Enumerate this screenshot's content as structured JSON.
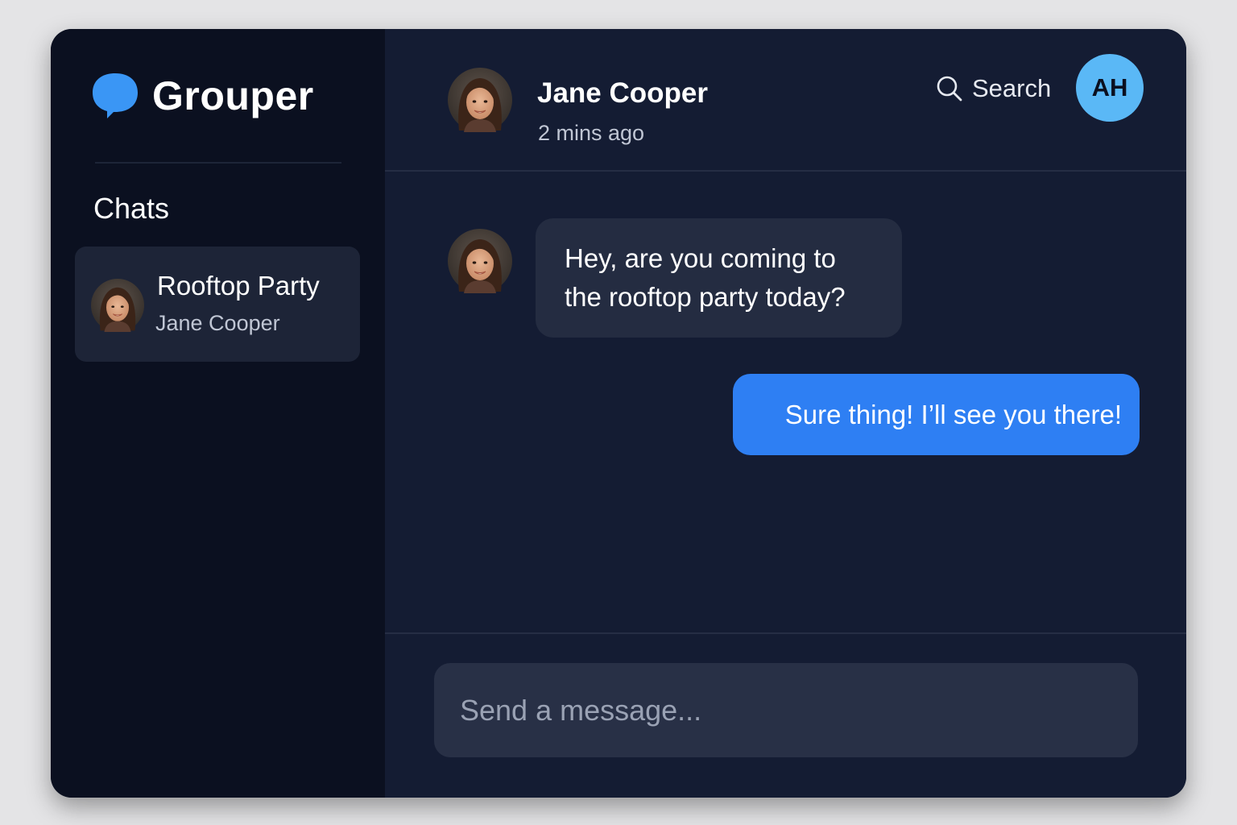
{
  "app": {
    "name": "Grouper",
    "logo_icon": "chat-bubble-icon",
    "accent_color": "#2e7ff3"
  },
  "sidebar": {
    "heading": "Chats",
    "chats": [
      {
        "title": "Rooftop Party",
        "subtitle": "Jane Cooper",
        "selected": true,
        "avatar": "jane-cooper-avatar"
      }
    ]
  },
  "conversation": {
    "contact_name": "Jane Cooper",
    "status": "2 mins ago",
    "search_label": "Search",
    "search_icon": "search-icon",
    "user_initials": "AH",
    "user_avatar_color": "#5ab8f6"
  },
  "messages": [
    {
      "direction": "incoming",
      "sender": "Jane Cooper",
      "line1": "Hey, are you coming to",
      "line2": "the rooftop party today?"
    },
    {
      "direction": "outgoing",
      "text": "Sure thing! I’ll see you there!"
    }
  ],
  "composer": {
    "placeholder": "Send a message..."
  }
}
